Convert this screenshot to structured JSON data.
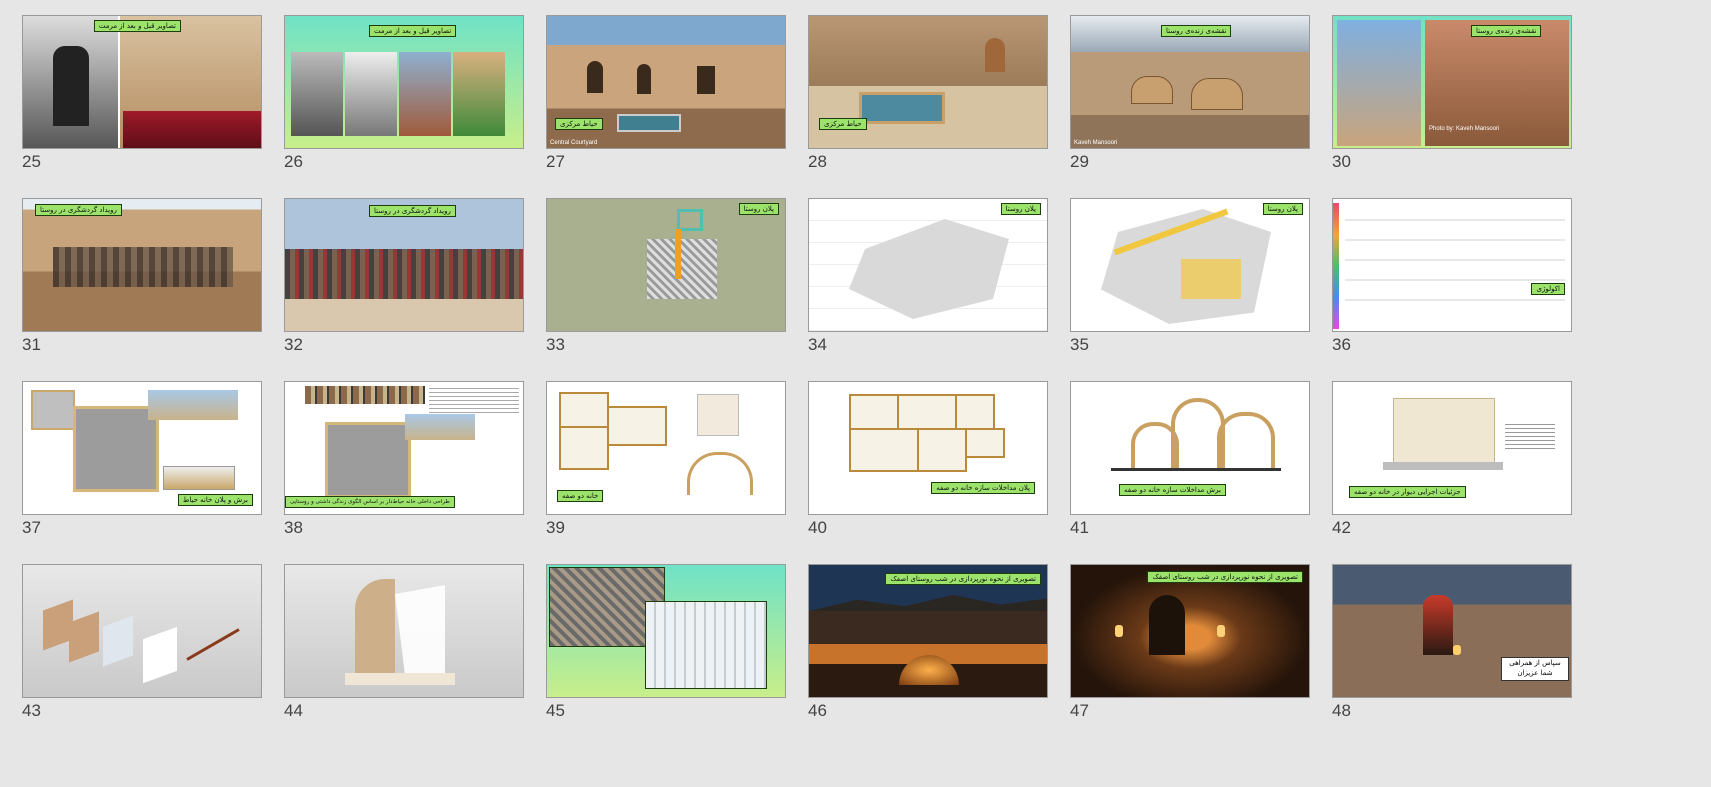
{
  "slides": [
    {
      "number": "25",
      "caption": "تصاویر قبل و بعد از مرمت",
      "credit": ""
    },
    {
      "number": "26",
      "caption": "تصاویر قبل و بعد از مرمت",
      "credit": ""
    },
    {
      "number": "27",
      "caption": "حیاط مرکزی",
      "credit": "Central Courtyard"
    },
    {
      "number": "28",
      "caption": "حیاط مرکزی",
      "credit": ""
    },
    {
      "number": "29",
      "caption": "نقشه‌ی زنده‌ی روستا",
      "credit": "Kaveh Mansoori"
    },
    {
      "number": "30",
      "caption": "نقشه‌ی زنده‌ی روستا",
      "credit": "Photo by: Kaveh Mansoori"
    },
    {
      "number": "31",
      "caption": "رویداد گردشگری در روستا",
      "credit": ""
    },
    {
      "number": "32",
      "caption": "رویداد گردشگری در روستا",
      "credit": ""
    },
    {
      "number": "33",
      "caption": "پلان روستا",
      "credit": ""
    },
    {
      "number": "34",
      "caption": "پلان روستا",
      "credit": ""
    },
    {
      "number": "35",
      "caption": "پلان روستا",
      "credit": ""
    },
    {
      "number": "36",
      "caption": "اکولوژی",
      "credit": ""
    },
    {
      "number": "37",
      "caption": "برش و پلان خانه حیاط",
      "credit": ""
    },
    {
      "number": "38",
      "caption": "طراحی داخلی خانه حیاط‌دار بر اساس الگوی زندگی داشتی و روستایی",
      "credit": ""
    },
    {
      "number": "39",
      "caption": "خانه دو صفه",
      "credit": ""
    },
    {
      "number": "40",
      "caption": "پلان مداخلات سازه خانه دو صفه",
      "credit": ""
    },
    {
      "number": "41",
      "caption": "برش مداخلات سازه خانه دو صفه",
      "credit": ""
    },
    {
      "number": "42",
      "caption": "جزئیات اجرایی دیوار در خانه دو صفه",
      "credit": ""
    },
    {
      "number": "43",
      "caption": "",
      "credit": ""
    },
    {
      "number": "44",
      "caption": "",
      "credit": ""
    },
    {
      "number": "45",
      "caption": "",
      "credit": ""
    },
    {
      "number": "46",
      "caption": "تصویری از نحوه نورپردازی در شب روستای اصفک",
      "credit": ""
    },
    {
      "number": "47",
      "caption": "تصویری از نحوه نورپردازی در شب روستای اصفک",
      "credit": ""
    },
    {
      "number": "48",
      "caption": "سپاس از همراهی\nشما عزیزان",
      "credit": ""
    }
  ],
  "colors": {
    "background": "#e6e6e6",
    "caption_fill": "#9be36b",
    "caption_border": "#1d3d0c"
  }
}
